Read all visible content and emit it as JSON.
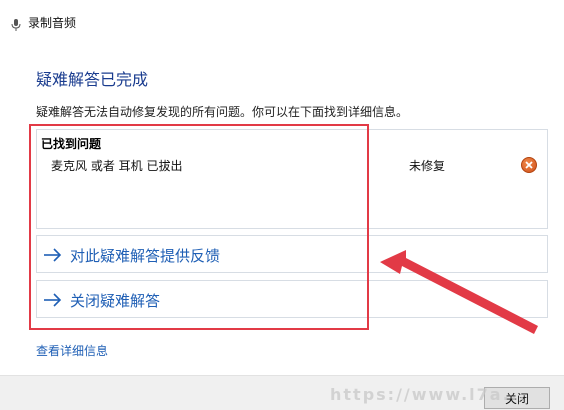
{
  "window": {
    "title": "录制音频",
    "icon": "microphone-icon"
  },
  "heading": "疑难解答已完成",
  "description": "疑难解答无法自动修复发现的所有问题。你可以在下面找到详细信息。",
  "problems": {
    "header": "已找到问题",
    "items": [
      {
        "name": "麦克风 或者 耳机 已拔出",
        "status": "未修复",
        "status_icon": "error-icon"
      }
    ]
  },
  "links": {
    "feedback": "对此疑难解答提供反馈",
    "close_troubleshooter": "关闭疑难解答"
  },
  "details_link": "查看详细信息",
  "footer": {
    "close_button": "关闭"
  },
  "watermark": "https://www.l7a...",
  "colors": {
    "link": "#1f5fb5",
    "heading": "#1a3c8f",
    "annotation": "#e23a46",
    "error": "#d0501a"
  }
}
